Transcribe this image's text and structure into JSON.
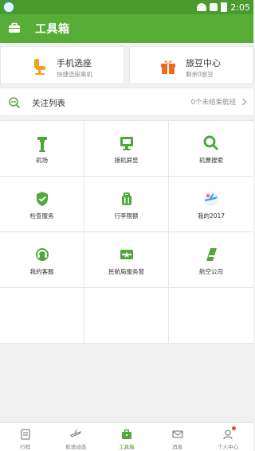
{
  "status_bar": {
    "time": "2:05",
    "icons": [
      "app-icon",
      "wifi-icon",
      "signal-icon",
      "battery-icon"
    ]
  },
  "app_bar": {
    "title": "工具箱",
    "icon": "toolbox-icon"
  },
  "quick_cards": [
    {
      "title": "手机选座",
      "subtitle": "快捷选座乘机",
      "icon": "seat-icon",
      "color": "#f3a11a"
    },
    {
      "title": "旅豆中心",
      "subtitle": "剩余0旅豆",
      "icon": "gift-icon",
      "color": "#ea6b1b"
    }
  ],
  "follow": {
    "label": "关注列表",
    "right_text": "0个未结束航班",
    "icon": "flight-search-icon"
  },
  "tools": [
    {
      "label": "机场",
      "icon": "airport-tower-icon"
    },
    {
      "label": "接机屏显",
      "icon": "display-screen-icon"
    },
    {
      "label": "机票搜索",
      "icon": "search-icon"
    },
    {
      "label": "检查服务",
      "icon": "shield-check-icon"
    },
    {
      "label": "行李限额",
      "icon": "luggage-icon"
    },
    {
      "label": "我的2017",
      "icon": "plane-badge-icon"
    },
    {
      "label": "我的客服",
      "icon": "headset-icon"
    },
    {
      "label": "民航局服务窗",
      "icon": "caac-emblem-icon"
    },
    {
      "label": "航空公司",
      "icon": "airline-tail-icon"
    },
    {
      "label": "",
      "icon": ""
    },
    {
      "label": "",
      "icon": ""
    },
    {
      "label": "",
      "icon": ""
    }
  ],
  "tabs": [
    {
      "label": "行程",
      "icon": "itinerary-icon",
      "active": false
    },
    {
      "label": "航班动态",
      "icon": "plane-icon",
      "active": false
    },
    {
      "label": "工具箱",
      "icon": "toolbox-icon",
      "active": true
    },
    {
      "label": "消息",
      "icon": "mail-icon",
      "active": false
    },
    {
      "label": "个人中心",
      "icon": "person-icon",
      "active": false,
      "has_badge": true
    }
  ],
  "colors": {
    "primary": "#57ad35",
    "status_bar": "#4b9a2e",
    "icon_green": "#4ea83a",
    "badge_red": "#e24a3c"
  }
}
